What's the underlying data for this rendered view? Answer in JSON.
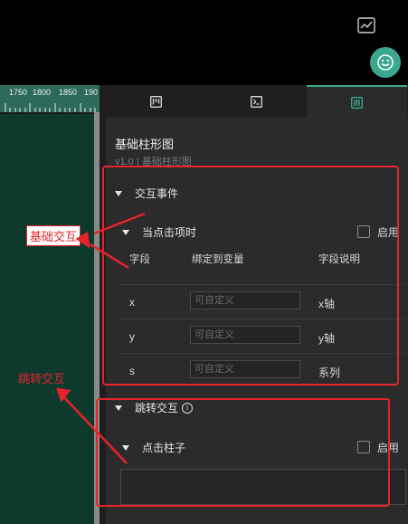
{
  "topbar": {
    "chart_icon": "chart-line-icon",
    "fab_icon": "smiley-icon",
    "accent": "#3aa88e"
  },
  "ruler": {
    "labels": [
      "1750",
      "1800",
      "1850",
      "190"
    ]
  },
  "tabs": [
    {
      "icon": "kanban-icon",
      "active": false
    },
    {
      "icon": "terminal-icon",
      "active": false
    },
    {
      "icon": "sliders-icon",
      "active": true
    }
  ],
  "panel": {
    "title": "基础柱形图",
    "subtitle": "v1.0 | 基础柱形图"
  },
  "interaction": {
    "section_label": "交互事件",
    "on_click_label": "当点击项时",
    "enable_label": "启用",
    "columns": [
      "字段",
      "绑定到变量",
      "字段说明"
    ],
    "rows": [
      {
        "field": "x",
        "placeholder": "可自定义",
        "desc": "x轴"
      },
      {
        "field": "y",
        "placeholder": "可自定义",
        "desc": "y轴"
      },
      {
        "field": "s",
        "placeholder": "可自定义",
        "desc": "系列"
      }
    ]
  },
  "jump": {
    "section_label": "跳转交互",
    "click_bar_label": "点击柱子",
    "enable_label": "启用"
  },
  "annotations": {
    "basic_label": "基础交互",
    "jump_label": "跳转交互",
    "color": "#e8232b"
  }
}
